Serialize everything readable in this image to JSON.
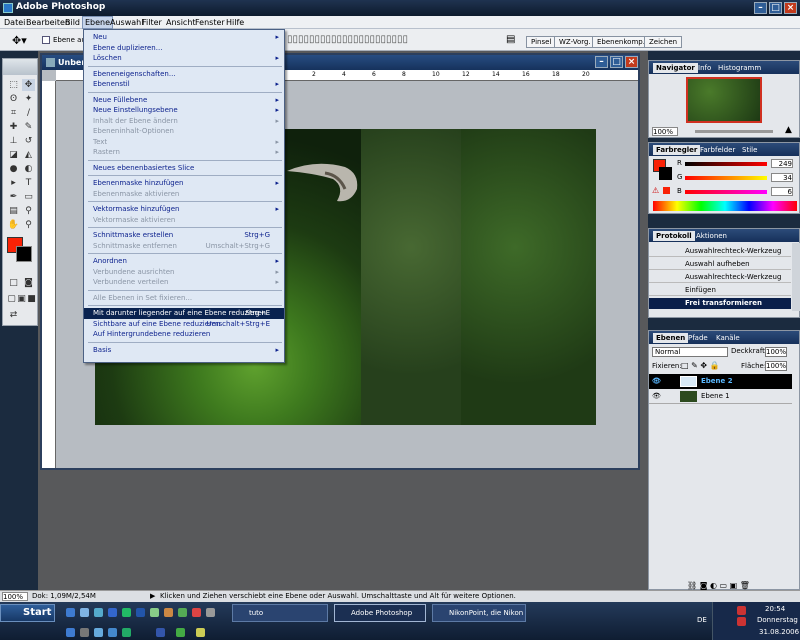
{
  "app_title": "Adobe Photoshop",
  "menu_bar": [
    "Datei",
    "Bearbeiten",
    "Bild",
    "Ebene",
    "Auswahl",
    "Filter",
    "Ansicht",
    "Fenster",
    "Hilfe"
  ],
  "options_bar": {
    "checkbox_label": "Ebene au"
  },
  "palette_well_tabs": [
    "Pinsel",
    "WZ-Vorg.",
    "Ebenenkomp.",
    "Zeichen"
  ],
  "document": {
    "title_fragment": "Unben",
    "ruler_marks": [
      "2",
      "4",
      "6",
      "8",
      "10",
      "12",
      "14",
      "16",
      "18",
      "20"
    ]
  },
  "ebene_menu": [
    {
      "label": "Neu",
      "arrow": true
    },
    {
      "label": "Ebene duplizieren..."
    },
    {
      "label": "Löschen",
      "arrow": true
    },
    {
      "sep": true
    },
    {
      "label": "Ebeneneigenschaften..."
    },
    {
      "label": "Ebenenstil",
      "arrow": true
    },
    {
      "sep": true
    },
    {
      "label": "Neue Füllebene",
      "arrow": true
    },
    {
      "label": "Neue Einstellungsebene",
      "arrow": true
    },
    {
      "label": "Inhalt der Ebene ändern",
      "arrow": true,
      "disabled": true
    },
    {
      "label": "Ebeneninhalt-Optionen",
      "disabled": true
    },
    {
      "label": "Text",
      "arrow": true,
      "disabled": true
    },
    {
      "label": "Rastern",
      "arrow": true,
      "disabled": true
    },
    {
      "sep": true
    },
    {
      "label": "Neues ebenenbasiertes Slice"
    },
    {
      "sep": true
    },
    {
      "label": "Ebenenmaske hinzufügen",
      "arrow": true
    },
    {
      "label": "Ebenenmaske aktivieren",
      "disabled": true
    },
    {
      "sep": true
    },
    {
      "label": "Vektormaske hinzufügen",
      "arrow": true
    },
    {
      "label": "Vektormaske aktivieren",
      "disabled": true
    },
    {
      "sep": true
    },
    {
      "label": "Schnittmaske erstellen",
      "shortcut": "Strg+G"
    },
    {
      "label": "Schnittmaske entfernen",
      "shortcut": "Umschalt+Strg+G",
      "disabled": true
    },
    {
      "sep": true
    },
    {
      "label": "Anordnen",
      "arrow": true
    },
    {
      "label": "Verbundene ausrichten",
      "arrow": true,
      "disabled": true
    },
    {
      "label": "Verbundene verteilen",
      "arrow": true,
      "disabled": true
    },
    {
      "sep": true
    },
    {
      "label": "Alle Ebenen in Set fixieren...",
      "disabled": true
    },
    {
      "sep": true
    },
    {
      "label": "Mit darunter liegender auf eine Ebene reduzieren",
      "shortcut": "Strg+E",
      "highlighted": true
    },
    {
      "label": "Sichtbare auf eine Ebene reduzieren",
      "shortcut": "Umschalt+Strg+E"
    },
    {
      "label": "Auf Hintergrundebene reduzieren"
    },
    {
      "sep": true
    },
    {
      "label": "Basis",
      "arrow": true
    }
  ],
  "navigator": {
    "tabs": [
      "Navigator",
      "Info",
      "Histogramm"
    ],
    "zoom": "100%"
  },
  "color_panel": {
    "tabs": [
      "Farbregler",
      "Farbfelder",
      "Stile"
    ],
    "r_label": "R",
    "r": "249",
    "g_label": "G",
    "g": "34",
    "b_label": "B",
    "b": "6",
    "fg_color": "#f92206",
    "bg_color": "#000000"
  },
  "history_panel": {
    "tabs": [
      "Protokoll",
      "Aktionen"
    ],
    "items": [
      "Auswahlrechteck-Werkzeug",
      "Auswahl aufheben",
      "Auswahlrechteck-Werkzeug",
      "Einfügen",
      "Frei transformieren"
    ]
  },
  "layers_panel": {
    "tabs": [
      "Ebenen",
      "Pfade",
      "Kanäle"
    ],
    "blend_mode": "Normal",
    "opacity_label": "Deckkraft:",
    "opacity": "100%",
    "lock_label": "Fixieren:",
    "fill_label": "Fläche:",
    "fill": "100%",
    "layers": [
      "Ebene 2",
      "Ebene 1"
    ]
  },
  "status_bar": {
    "zoom": "100%",
    "doc": "Dok: 1,09M/2,54M",
    "hint": "Klicken und Ziehen verschiebt eine Ebene oder Auswahl. Umschalttaste und Alt für weitere Optionen."
  },
  "taskbar": {
    "start": "Start",
    "tasks": [
      "tuto",
      "Adobe Photoshop",
      "NikonPoint, die Nikon ..."
    ],
    "lang": "DE",
    "time": "20:54",
    "day": "Donnerstag",
    "date": "31.08.2006"
  }
}
